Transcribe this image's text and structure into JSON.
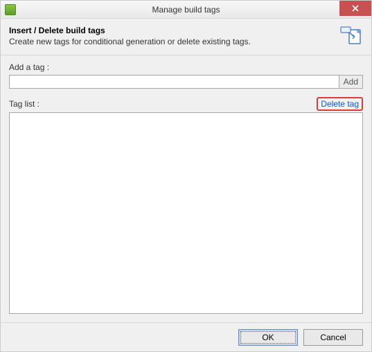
{
  "titlebar": {
    "title": "Manage build tags"
  },
  "header": {
    "title": "Insert / Delete build tags",
    "description": "Create new tags for conditional generation or delete existing tags."
  },
  "body": {
    "add_label": "Add a tag :",
    "add_input_value": "",
    "add_button_label": "Add",
    "taglist_label": "Tag list :",
    "delete_button_label": "Delete tag",
    "taglist_items": []
  },
  "footer": {
    "ok_label": "OK",
    "cancel_label": "Cancel"
  }
}
